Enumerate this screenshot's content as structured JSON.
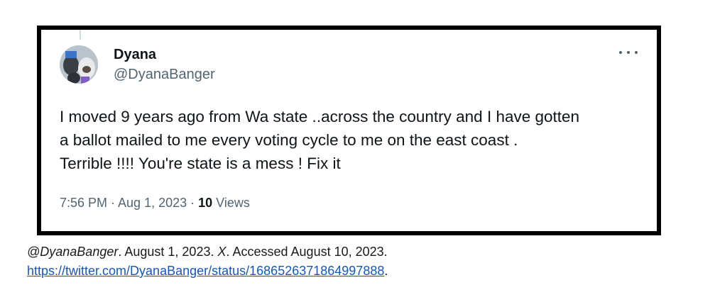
{
  "tweet": {
    "author_name": "Dyana",
    "author_handle": "@DyanaBanger",
    "text": "I moved 9 years ago from Wa state ..across the country and I have gotten\na ballot mailed to me every voting cycle to me on the  east coast .\nTerrible !!!!  You're state is a mess !  Fix it",
    "time_date": "7:56 PM · Aug 1, 2023 · ",
    "views_count": "10",
    "views_label": " Views",
    "more_icon": "more-horizontal-icon"
  },
  "citation": {
    "handle": "@DyanaBanger",
    "date": ". August 1, 2023. ",
    "platform": "X",
    "accessed": ". Accessed August 10, 2023.",
    "url": "https://twitter.com/DyanaBanger/status/1686526371864997888",
    "trailing": "."
  },
  "colors": {
    "border": "#000000",
    "handle_gray": "#536471",
    "link_blue": "#1a56b0"
  }
}
